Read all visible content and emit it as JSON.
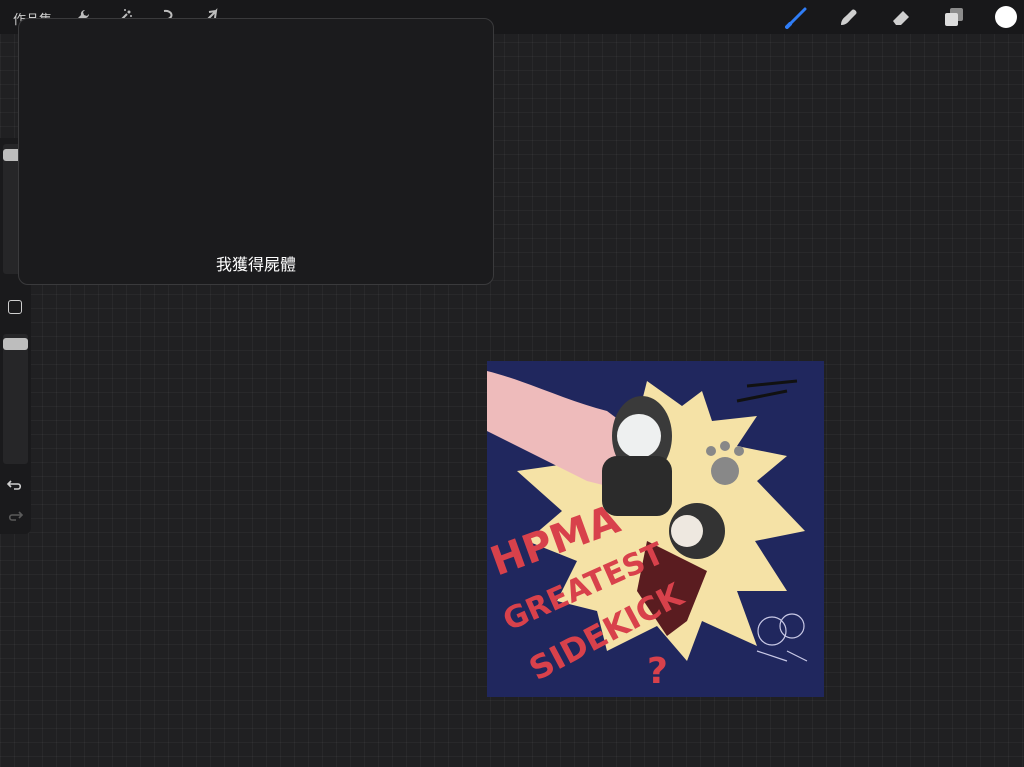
{
  "toolbar": {
    "gallery_label": "作品集",
    "left_icons": [
      "wrench-icon",
      "magic-wand-icon",
      "selection-icon",
      "transform-arrow-icon"
    ],
    "right_icons": [
      "brush-icon",
      "smudge-icon",
      "eraser-icon",
      "layers-icon",
      "color-picker"
    ],
    "accent_color": "#2f7df6",
    "current_color": "#ffffff"
  },
  "sidebar": {
    "brush_size_level": 0.93,
    "opacity_level": 1.0
  },
  "popup": {
    "message": "我獲得屍體"
  },
  "artwork": {
    "background_color": "#20275e",
    "burst_color": "#f5e2a6",
    "text_color": "#d8414b",
    "lines": [
      "HPMA",
      "GREATEST",
      "SIDEKICK",
      "?"
    ]
  }
}
